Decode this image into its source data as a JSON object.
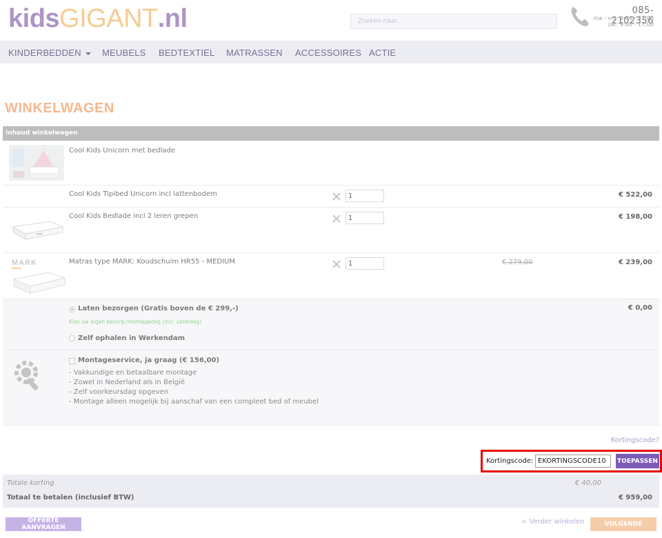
{
  "header": {
    "logo": {
      "part1": "kids",
      "part2": "GIGANT",
      "part3": ".nl"
    },
    "search_placeholder": "Zoeken naar...",
    "phone": "085-2102356",
    "hours_weekday": "ma - vrij: 9:00 - 21:00",
    "hours_saturday": "zat: 9:00 - 17:00"
  },
  "nav": {
    "items": [
      {
        "label": "KINDERBEDDEN"
      },
      {
        "label": "MEUBELS"
      },
      {
        "label": "BEDTEXTIEL"
      },
      {
        "label": "MATRASSEN"
      },
      {
        "label": "ACCESSOIRES"
      },
      {
        "label": "ACTIE"
      }
    ]
  },
  "cart": {
    "title": "WINKELWAGEN",
    "table_header": "Inhoud winkelwagen",
    "items": [
      {
        "name": "Cool Kids Unicorn met bedlade"
      },
      {
        "name": "Cool Kids Tipibed Unicorn incl lattenbodem",
        "quantity": "1",
        "price": "€ 522,00"
      },
      {
        "name": "Cool Kids Bedlade incl 2 leren grepen",
        "quantity": "1",
        "price": "€ 198,00"
      },
      {
        "name": "Matras type MARK: Koudschuim HR55 - MEDIUM",
        "quantity": "1",
        "old_price": "€ 279,00",
        "price": "€ 239,00",
        "thumb_text": "MARK"
      }
    ],
    "shipping": {
      "option_delivery": "Laten bezorgen (Gratis boven de € 299,-)",
      "delivery_link": "Kies uw eigen bezorg-/montagedag (incl. zaterdag)",
      "option_pickup": "Zelf ophalen in Werkendam",
      "price": "€ 0,00"
    },
    "assembly": {
      "label": "Montageservice, ja graag (€ 156,00)",
      "bullets": [
        "- Vakkundige en betaalbare montage",
        "- Zowel in Nederland als in België",
        "- Zelf voorkeursdag opgeven",
        "- Montage alleen mogelijk bij aanschaf van een compleet bed of meubel"
      ]
    },
    "coupon": {
      "toggle_link": "Kortingscode?",
      "label": "Kortingscode:",
      "value": "EKORTINGSCODE10",
      "apply_label": "TOEPASSEN"
    },
    "totals": {
      "discount_label": "Totale korting",
      "discount_value": "€ 40,00",
      "total_label": "Totaal te betalen (inclusief BTW)",
      "total_value": "€ 959,00"
    },
    "actions": {
      "quote_label": "OFFERTE AANVRAGEN",
      "continue_label": "< Verder winkelen",
      "next_label": "VOLGENDE"
    }
  }
}
